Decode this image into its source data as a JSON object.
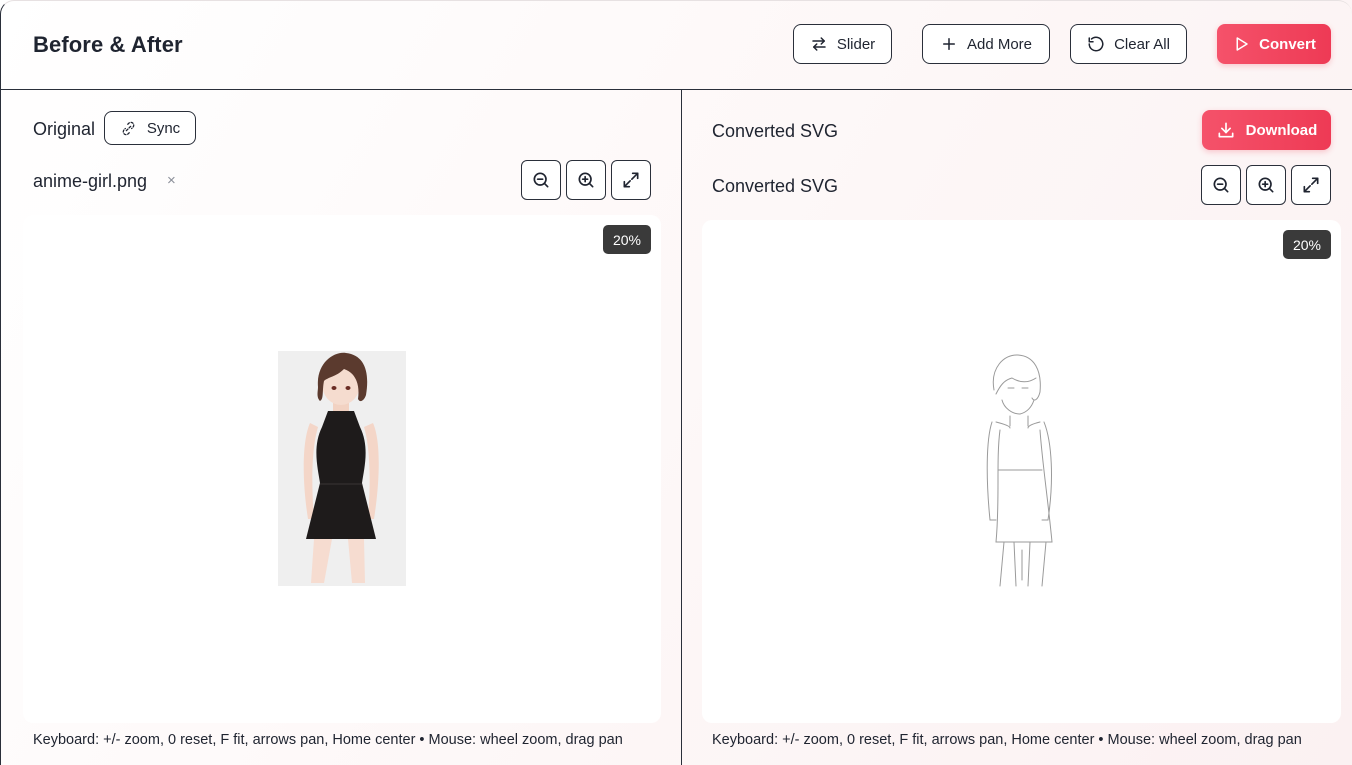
{
  "header": {
    "title": "Before & After",
    "buttons": {
      "slider": "Slider",
      "add_more": "Add More",
      "clear_all": "Clear All",
      "convert": "Convert"
    }
  },
  "left_panel": {
    "label": "Original",
    "sync_label": "Sync",
    "filename": "anime-girl.png",
    "remove_symbol": "×",
    "zoom_level": "20%",
    "image_alt": "anime girl in black sleeveless dress",
    "hint": "Keyboard: +/- zoom, 0 reset, F fit, arrows pan, Home center • Mouse: wheel zoom, drag pan"
  },
  "right_panel": {
    "label": "Converted SVG",
    "sublabel": "Converted SVG",
    "download_label": "Download",
    "zoom_level": "20%",
    "hint": "Keyboard: +/- zoom, 0 reset, F fit, arrows pan, Home center • Mouse: wheel zoom, drag pan"
  },
  "colors": {
    "accent": "#ee3a55",
    "border": "#2a2f3a",
    "badge": "#3a3a3a"
  },
  "icons": [
    "swap-arrows-icon",
    "plus-icon",
    "rotate-ccw-icon",
    "play-icon",
    "unlink-icon",
    "zoom-out-icon",
    "zoom-in-icon",
    "expand-icon",
    "download-icon"
  ]
}
